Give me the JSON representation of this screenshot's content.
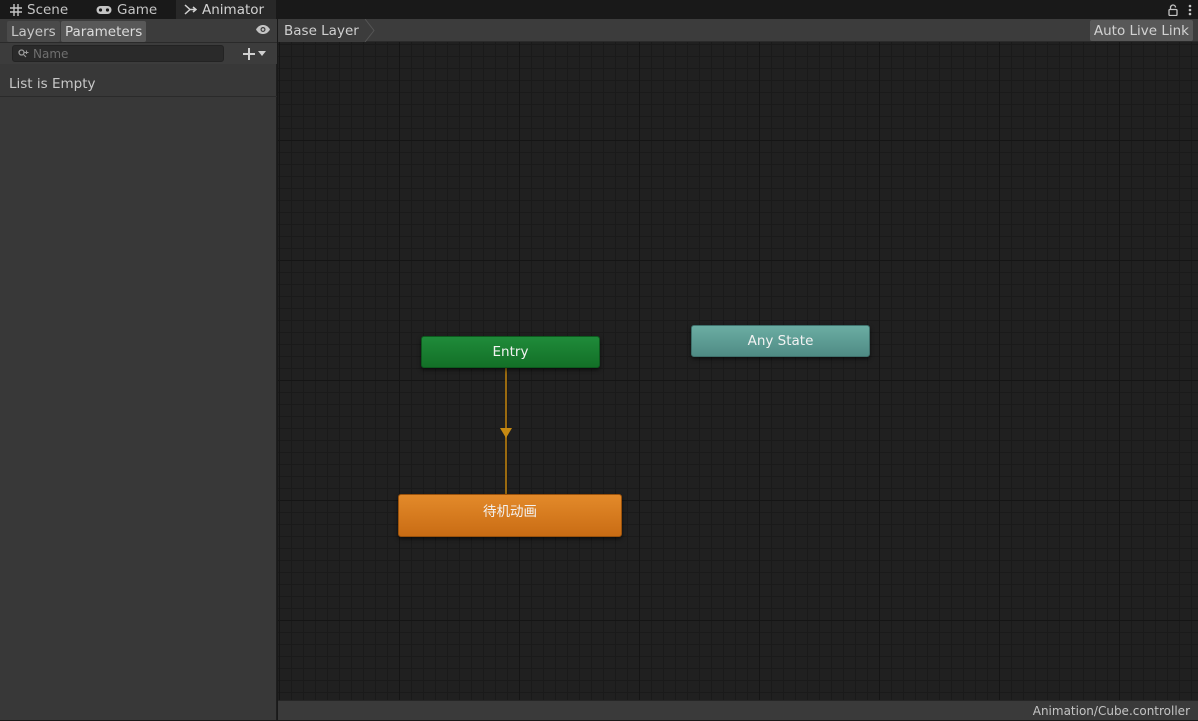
{
  "tabs": [
    {
      "label": "Scene",
      "icon": "grid-icon"
    },
    {
      "label": "Game",
      "icon": "gamepad-icon"
    },
    {
      "label": "Animator",
      "icon": "animator-icon",
      "active": true
    }
  ],
  "left_panel": {
    "tabs": [
      {
        "label": "Layers"
      },
      {
        "label": "Parameters",
        "active": true
      }
    ],
    "search": {
      "placeholder": "Name",
      "value": ""
    },
    "empty_text": "List is Empty"
  },
  "graph_toolbar": {
    "breadcrumb": [
      "Base Layer"
    ],
    "live_link_label": "Auto Live Link"
  },
  "states": {
    "entry": {
      "label": "Entry",
      "color": "#1a7f32"
    },
    "any_state": {
      "label": "Any State",
      "color": "#5f9e96"
    },
    "idle": {
      "label": "待机动画",
      "color": "#d97a1e",
      "is_default": true
    }
  },
  "transitions": [
    {
      "from": "Entry",
      "to": "待机动画",
      "color": "#9a6a0f"
    }
  ],
  "status_bar": {
    "path": "Animation/Cube.controller"
  }
}
